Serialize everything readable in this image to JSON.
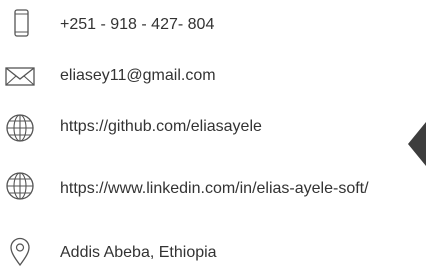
{
  "contacts": {
    "phone": {
      "icon": "phone-icon",
      "text": "+251 - 918 - 427- 804"
    },
    "email": {
      "icon": "mail-icon",
      "text": "eliasey11@gmail.com"
    },
    "github": {
      "icon": "globe-icon",
      "text": "https://github.com/eliasayele"
    },
    "linkedin": {
      "icon": "globe-icon",
      "text": "https://www.linkedin.com/in/elias-ayele-soft/"
    },
    "location": {
      "icon": "location-pin-icon",
      "text": "Addis Abeba, Ethiopia"
    }
  },
  "colors": {
    "text": "#333333",
    "icon_stroke": "#555555",
    "side_shape": "#3d3d3d"
  }
}
